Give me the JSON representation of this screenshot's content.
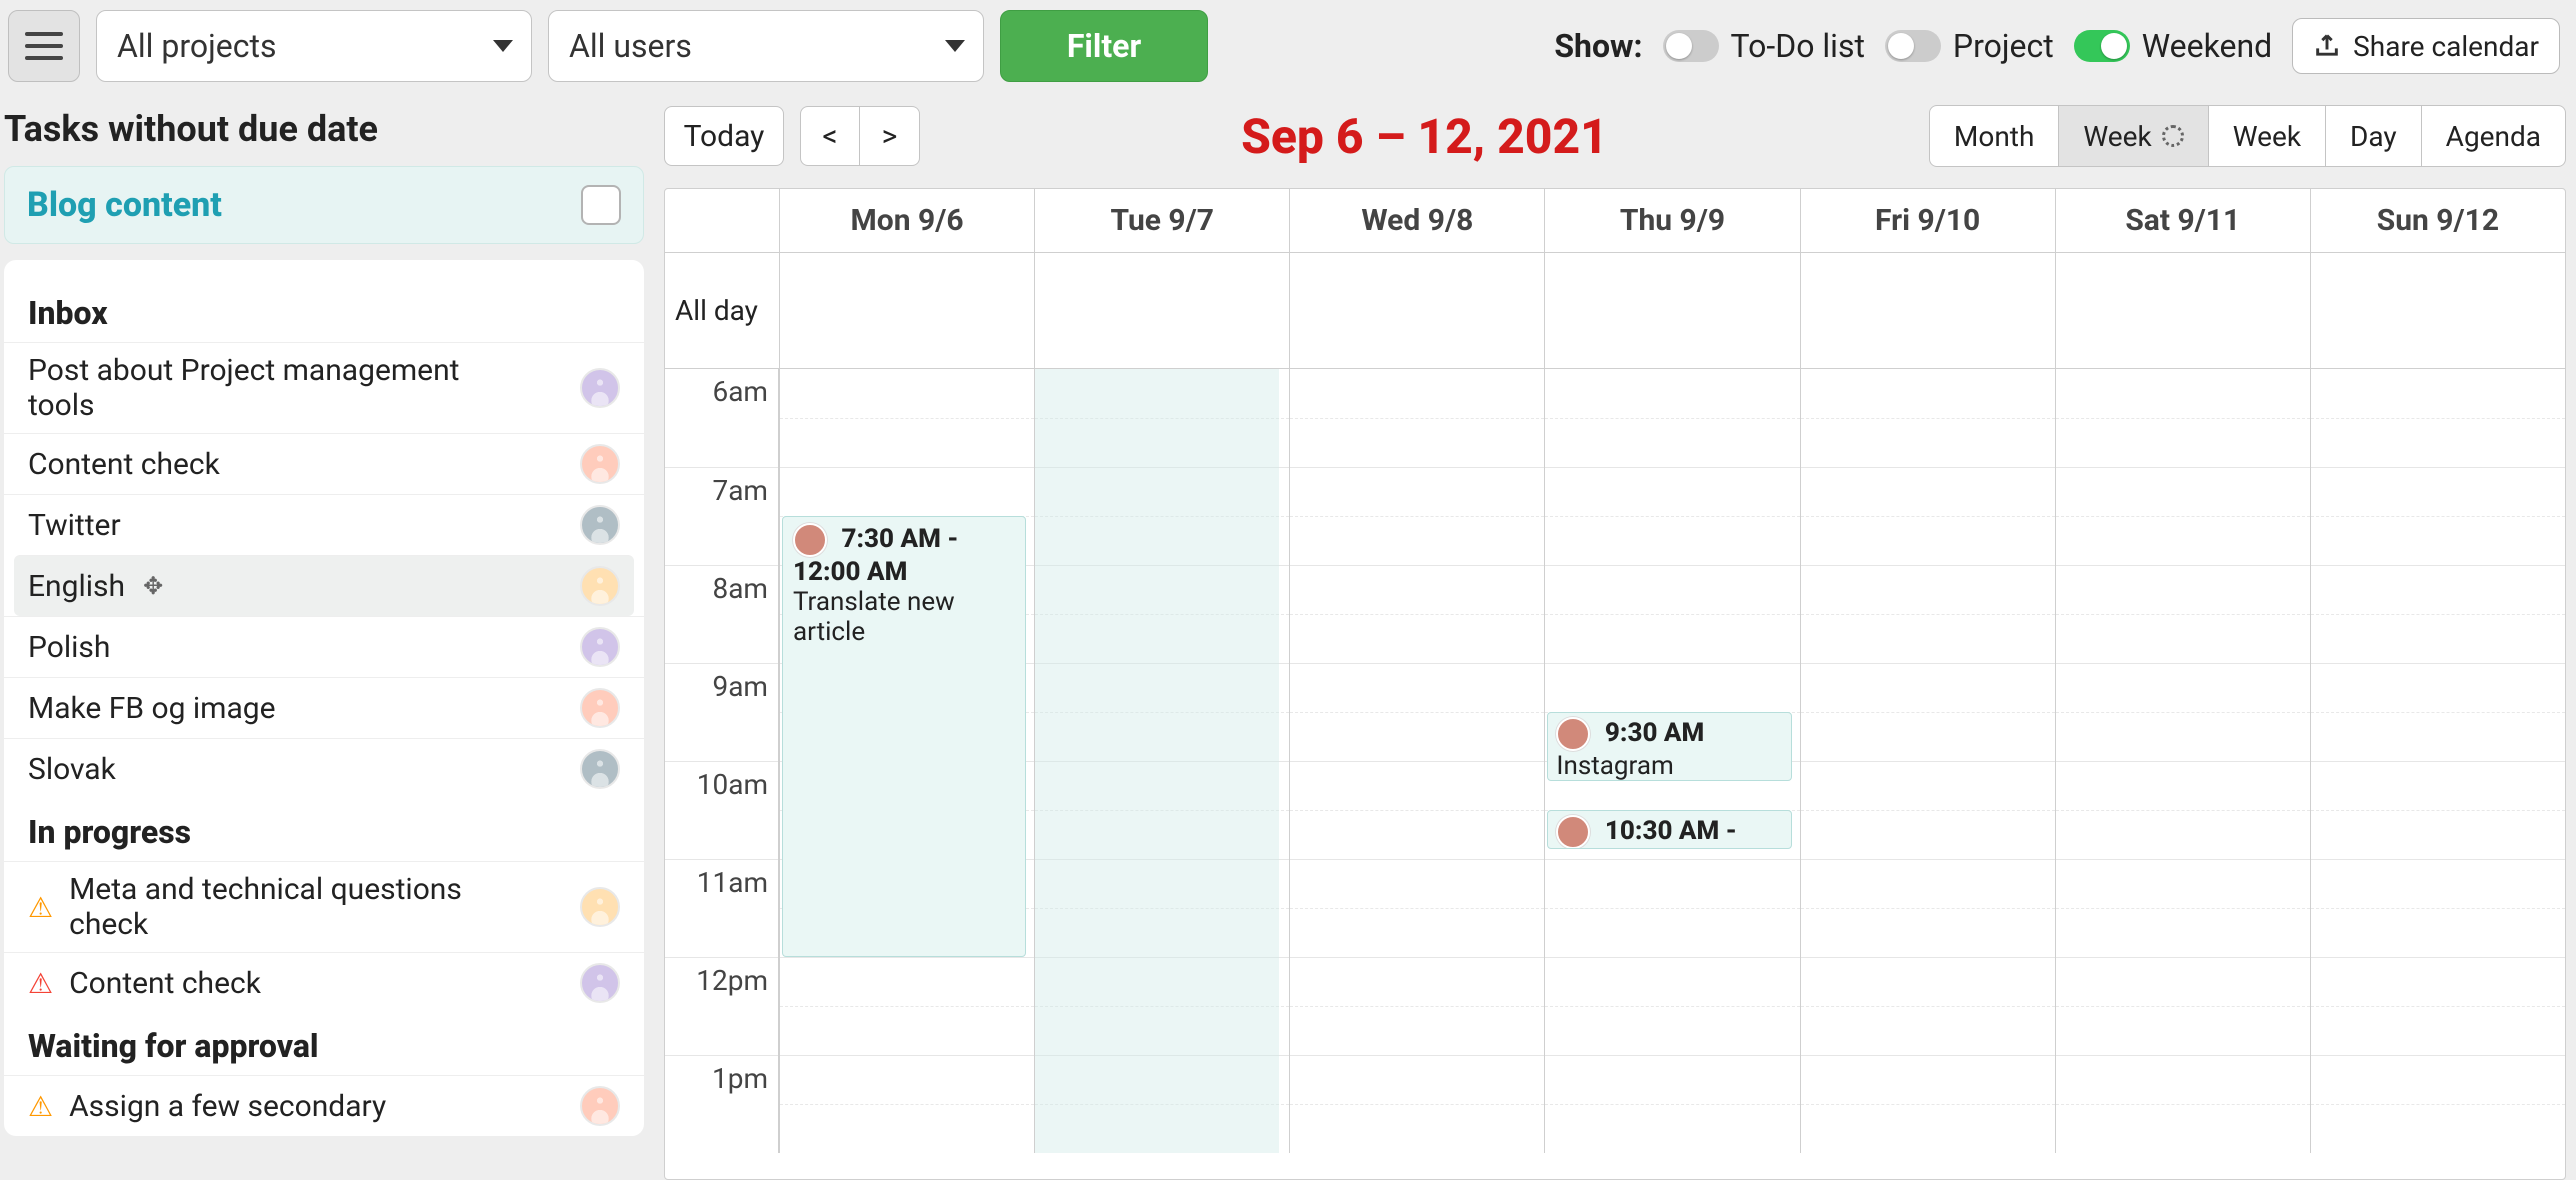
{
  "toolbar": {
    "projects_label": "All projects",
    "users_label": "All users",
    "filter_label": "Filter",
    "show_label": "Show:",
    "toggles": {
      "todo": {
        "label": "To-Do list",
        "on": false
      },
      "project": {
        "label": "Project",
        "on": false
      },
      "weekend": {
        "label": "Weekend",
        "on": true
      }
    },
    "share_label": "Share calendar"
  },
  "sidebar": {
    "title": "Tasks without due date",
    "project": {
      "name": "Blog content"
    },
    "groups": [
      {
        "name": "Inbox",
        "tasks": [
          {
            "title": "Post about Project management tools"
          },
          {
            "title": "Content check"
          },
          {
            "title": "Twitter"
          },
          {
            "title": "English",
            "hover": true,
            "moveIcon": true
          },
          {
            "title": "Polish"
          },
          {
            "title": "Make FB og image"
          },
          {
            "title": "Slovak"
          }
        ]
      },
      {
        "name": "In progress",
        "tasks": [
          {
            "title": "Meta and technical questions check",
            "warn": "orange"
          },
          {
            "title": "Content check",
            "warn": "red"
          }
        ]
      },
      {
        "name": "Waiting for approval",
        "tasks": [
          {
            "title": "Assign a few secondary",
            "warn": "orange"
          }
        ]
      }
    ]
  },
  "calendar": {
    "today_label": "Today",
    "prev_label": "<",
    "next_label": ">",
    "range_title": "Sep 6 – 12, 2021",
    "views": {
      "month": "Month",
      "week": "Week",
      "week2": "Week",
      "day": "Day",
      "agenda": "Agenda",
      "active": "week"
    },
    "allday_label": "All day",
    "days": [
      "Mon 9/6",
      "Tue 9/7",
      "Wed 9/8",
      "Thu 9/9",
      "Fri 9/10",
      "Sat 9/11",
      "Sun 9/12"
    ],
    "hours": [
      "6am",
      "7am",
      "8am",
      "9am",
      "10am",
      "11am",
      "12pm",
      "1pm"
    ],
    "events": [
      {
        "day": 0,
        "start": "7:30 AM",
        "end": "12:00 AM",
        "title": "Translate new article",
        "top_hour": 1.5,
        "height_hours": 4.5,
        "show_end": true
      },
      {
        "day": 3,
        "start": "9:30 AM",
        "end": "",
        "title": "Instagram",
        "top_hour": 3.5,
        "height_hours": 0.7,
        "show_end": false
      },
      {
        "day": 3,
        "start": "10:30 AM -",
        "end": "",
        "title": "",
        "top_hour": 4.5,
        "height_hours": 0.4,
        "show_end": false
      }
    ],
    "tue_highlight": true
  }
}
